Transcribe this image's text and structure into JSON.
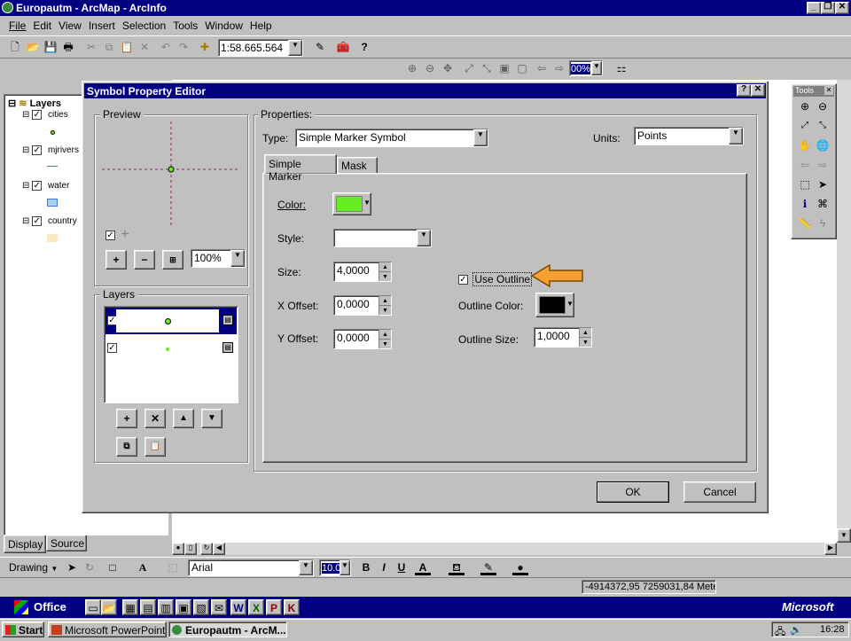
{
  "app": {
    "title": "Europautm - ArcMap - ArcInfo",
    "menu": [
      "File",
      "Edit",
      "View",
      "Insert",
      "Selection",
      "Tools",
      "Window",
      "Help"
    ],
    "scale": "1:58.665.564",
    "zoom_pct": "00%"
  },
  "toc": {
    "header": "Layers",
    "layers": [
      "cities",
      "mjrivers",
      "water",
      "country"
    ],
    "tabs": [
      "Display",
      "Source"
    ]
  },
  "tools_palette": {
    "title": "Tools"
  },
  "dialog": {
    "title": "Symbol Property Editor",
    "preview_label": "Preview",
    "preview_zoom": "100%",
    "layers_label": "Layers",
    "properties_label": "Properties:",
    "type_label": "Type:",
    "type_value": "Simple Marker Symbol",
    "units_label": "Units:",
    "units_value": "Points",
    "tabs": [
      "Simple Marker",
      "Mask"
    ],
    "color_label": "Color:",
    "style_label": "Style:",
    "size_label": "Size:",
    "size_value": "4,0000",
    "xoffset_label": "X Offset:",
    "xoffset_value": "0,0000",
    "yoffset_label": "Y Offset:",
    "yoffset_value": "0,0000",
    "use_outline_label": "Use Outline",
    "outline_color_label": "Outline Color:",
    "outline_size_label": "Outline Size:",
    "outline_size_value": "1,0000",
    "ok": "OK",
    "cancel": "Cancel",
    "marker_color": "#66ee22",
    "outline_color": "#000000"
  },
  "drawing": {
    "label": "Drawing",
    "font": "Arial",
    "font_size": "10.0"
  },
  "status": {
    "coords": "-4914372,95  7259031,84 Mete"
  },
  "office_bar": {
    "label": "Office",
    "brand": "Microsoft"
  },
  "taskbar": {
    "start": "Start",
    "items": [
      "Microsoft PowerPoint...",
      "Europautm - ArcM..."
    ],
    "clock": "16:28"
  }
}
